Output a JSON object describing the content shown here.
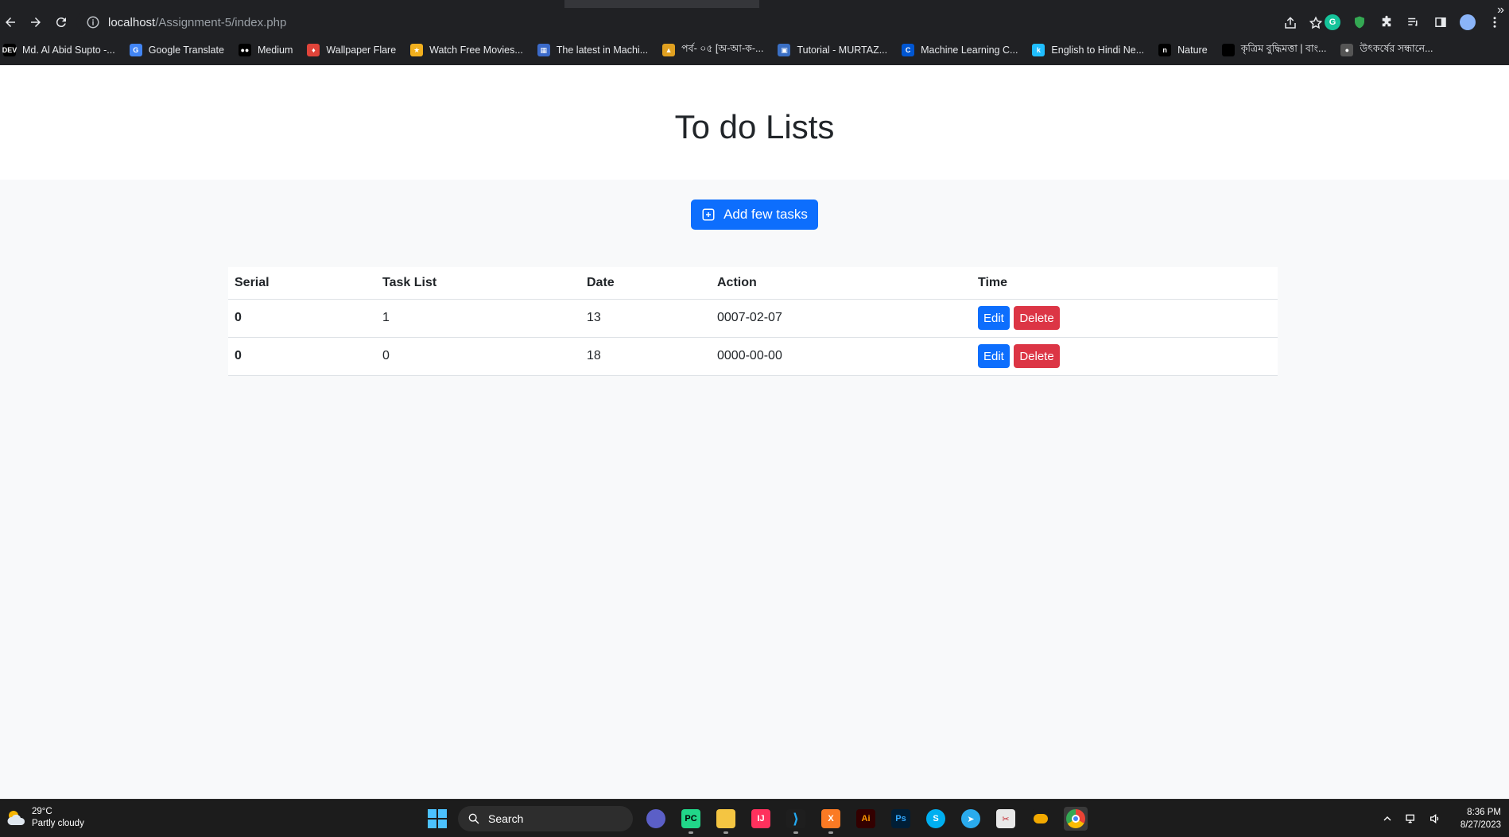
{
  "browser": {
    "url_host": "localhost",
    "url_path": "/Assignment-5/index.php",
    "bookmarks": [
      {
        "label": "Md. Al Abid Supto -...",
        "icon": "dev-icon",
        "color": "#000000",
        "glyph": "DEV"
      },
      {
        "label": "Google Translate",
        "icon": "google-translate-icon",
        "color": "#4285f4",
        "glyph": "G"
      },
      {
        "label": "Medium",
        "icon": "medium-icon",
        "color": "#000000",
        "glyph": "●●"
      },
      {
        "label": "Wallpaper Flare",
        "icon": "wallpaper-flare-icon",
        "color": "#e0443a",
        "glyph": "♦"
      },
      {
        "label": "Watch Free Movies...",
        "icon": "movies-icon",
        "color": "#f2b01e",
        "glyph": "★"
      },
      {
        "label": "The latest in Machi...",
        "icon": "papers-icon",
        "color": "#3b6ac9",
        "glyph": "▦"
      },
      {
        "label": "পর্ব- ০৫ [অ-আ-ক-...",
        "icon": "hat-icon",
        "color": "#e0a020",
        "glyph": "▲"
      },
      {
        "label": "Tutorial - MURTAZ...",
        "icon": "tutorial-icon",
        "color": "#3a6fc4",
        "glyph": "▣"
      },
      {
        "label": "Machine Learning C...",
        "icon": "coursera-icon",
        "color": "#0056d2",
        "glyph": "C"
      },
      {
        "label": "English to Hindi Ne...",
        "icon": "kaggle-icon",
        "color": "#20beff",
        "glyph": "k"
      },
      {
        "label": "Nature",
        "icon": "nature-icon",
        "color": "#000000",
        "glyph": "n"
      },
      {
        "label": "কৃত্রিম বুদ্ধিমত্তা | বাং...",
        "icon": "black-square-icon",
        "color": "#000000",
        "glyph": ""
      },
      {
        "label": "উৎকর্ষের সন্ধানে...",
        "icon": "shield-icon",
        "color": "#555555",
        "glyph": "●"
      }
    ]
  },
  "page": {
    "title": "To do Lists",
    "add_button_label": "Add few tasks",
    "table": {
      "headers": [
        "Serial",
        "Task List",
        "Date",
        "Action",
        "Time"
      ],
      "rows": [
        {
          "serial": "0",
          "task": "1",
          "date": "13",
          "action": "0007-02-07",
          "edit": "Edit",
          "delete": "Delete"
        },
        {
          "serial": "0",
          "task": "0",
          "date": "18",
          "action": "0000-00-00",
          "edit": "Edit",
          "delete": "Delete"
        }
      ]
    }
  },
  "taskbar": {
    "weather_temp": "29°C",
    "weather_desc": "Partly cloudy",
    "search_label": "Search",
    "time": "8:36 PM",
    "date": "8/27/2023"
  },
  "colors": {
    "primary": "#0d6efd",
    "danger": "#dc3545"
  }
}
